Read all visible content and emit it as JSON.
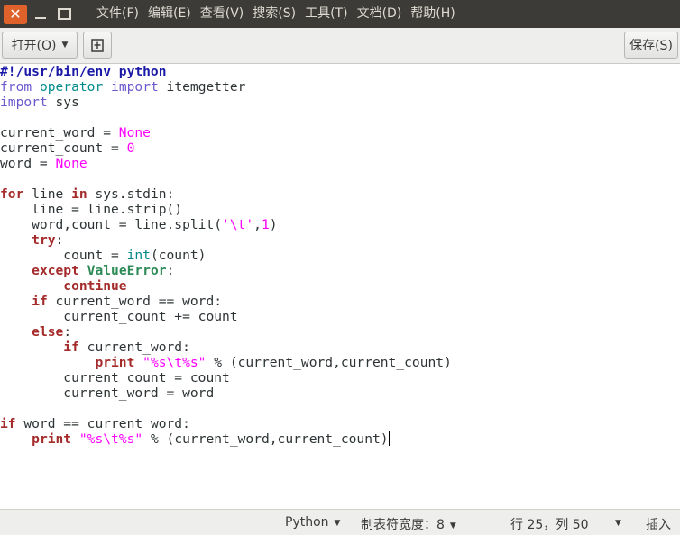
{
  "window": {
    "menus": [
      "文件(F)",
      "编辑(E)",
      "查看(V)",
      "搜索(S)",
      "工具(T)",
      "文档(D)",
      "帮助(H)"
    ]
  },
  "toolbar": {
    "open_label": "打开(O)",
    "save_label": "保存(S)"
  },
  "editor": {
    "lines": [
      "#!/usr/bin/env python",
      "from operator import itemgetter",
      "import sys",
      "",
      "current_word = None",
      "current_count = 0",
      "word = None",
      "",
      "for line in sys.stdin:",
      "    line = line.strip()",
      "    word,count = line.split('\\t',1)",
      "    try:",
      "        count = int(count)",
      "    except ValueError:",
      "        continue",
      "    if current_word == word:",
      "        current_count += count",
      "    else:",
      "        if current_word:",
      "            print \"%s\\t%s\" % (current_word,current_count)",
      "        current_count = count",
      "        current_word = word",
      "",
      "if word == current_word:",
      "    print \"%s\\t%s\" % (current_word,current_count)"
    ]
  },
  "statusbar": {
    "language": "Python",
    "tab_width": "制表符宽度：8",
    "position": "行 25，列 50",
    "mode": "插入"
  },
  "colors": {
    "menubar_bg": "#3c3b37",
    "close_button": "#e0622b",
    "keyword": "#a52a2a",
    "string": "#ff00ff",
    "builtin": "#008a8c"
  },
  "icons": {
    "close": "close-icon",
    "minimize": "minimize-icon",
    "maximize": "maximize-icon",
    "new_tab": "new-document-icon",
    "dropdown": "chevron-down-icon"
  }
}
